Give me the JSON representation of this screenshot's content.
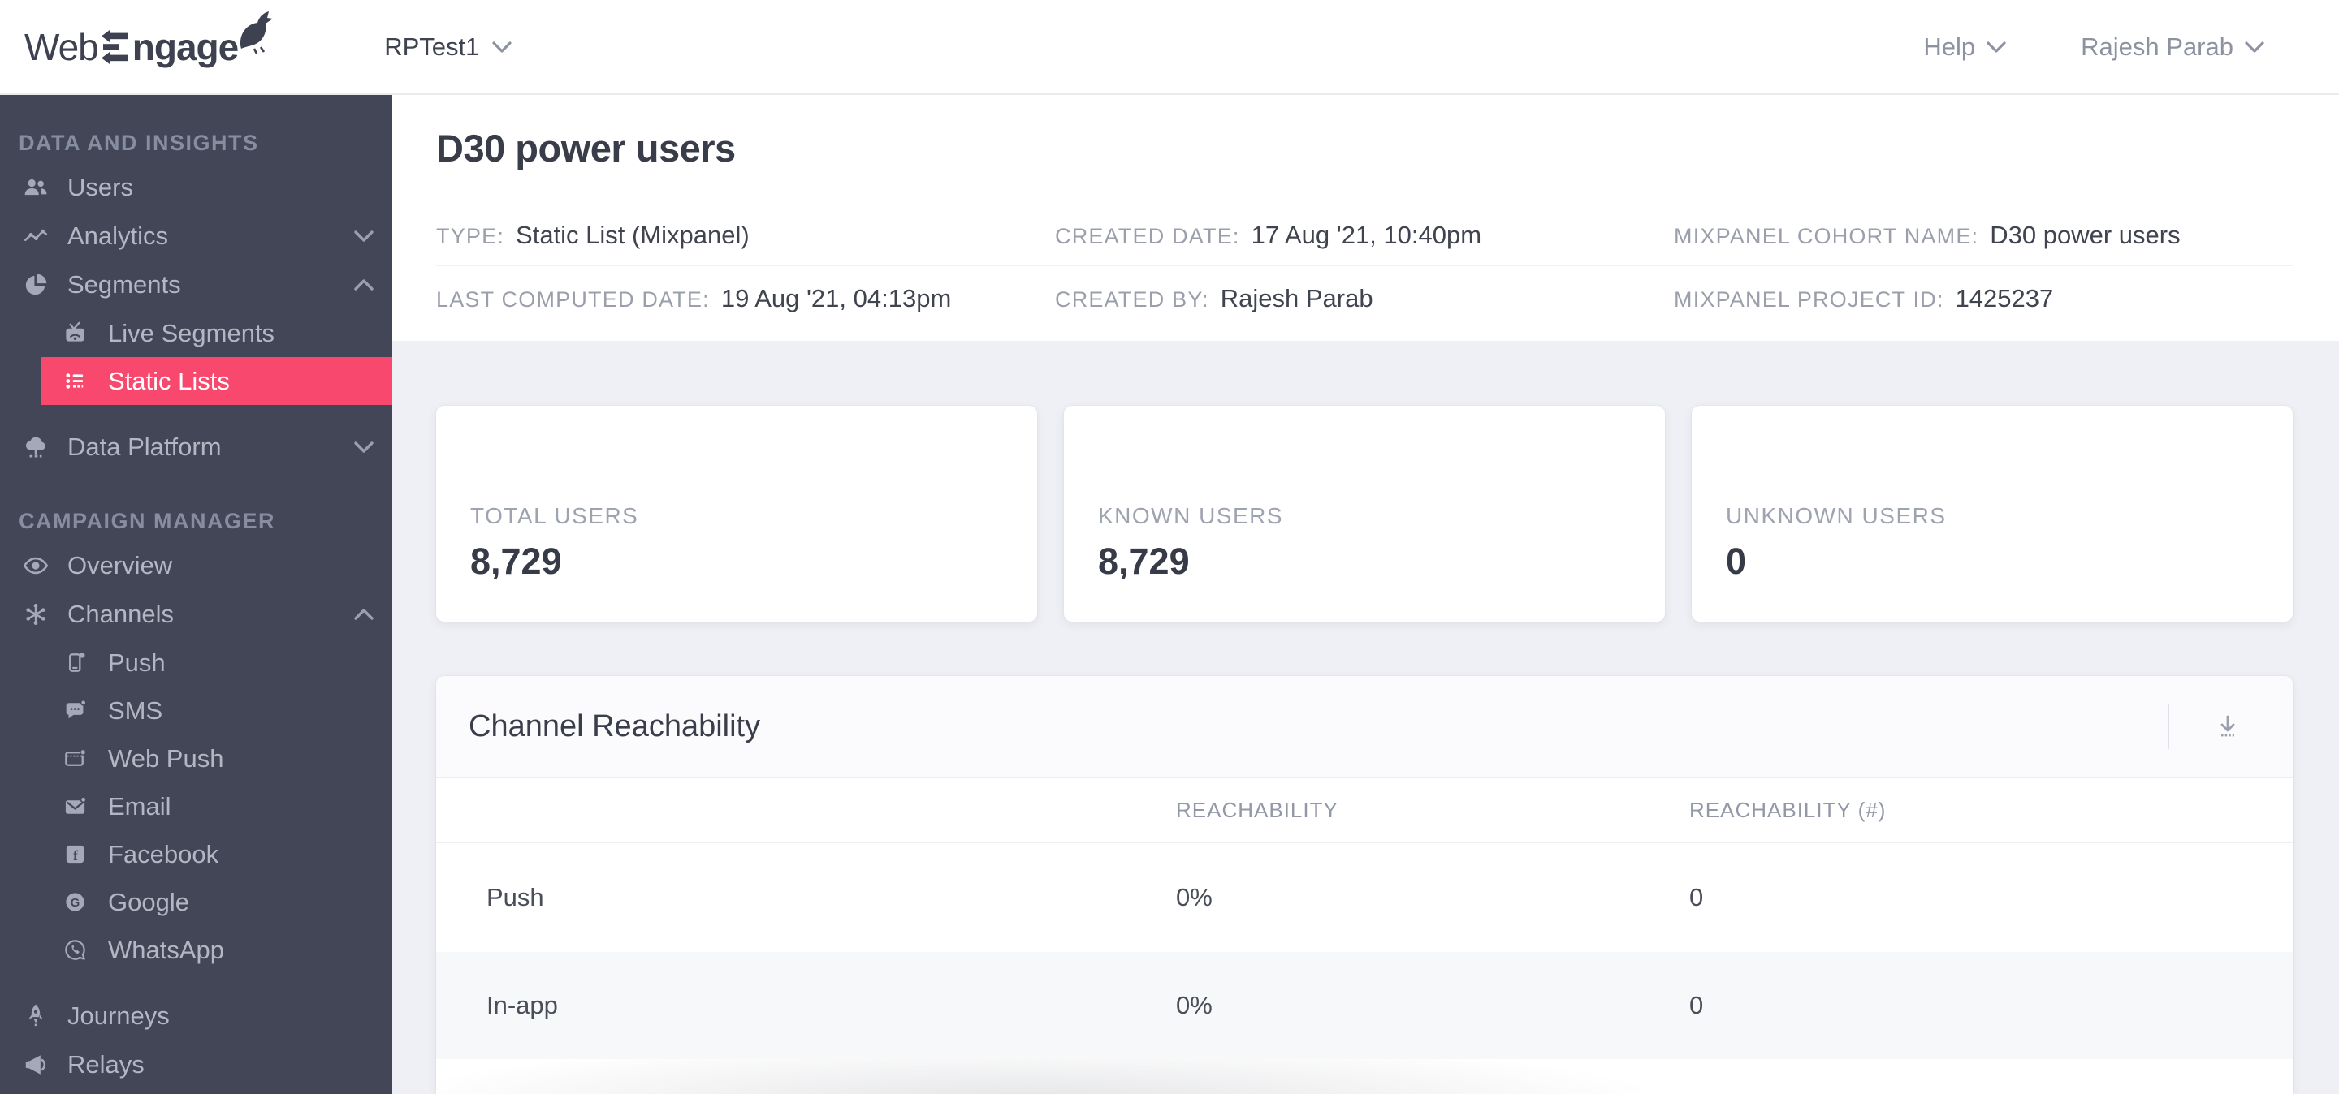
{
  "topbar": {
    "logo_web": "Web",
    "logo_engage": "ngage",
    "project": "RPTest1",
    "help_label": "Help",
    "user_name": "Rajesh Parab"
  },
  "sidebar": {
    "sections": [
      {
        "label": "DATA AND INSIGHTS",
        "items": [
          {
            "label": "Users",
            "icon": "users-icon"
          },
          {
            "label": "Analytics",
            "icon": "analytics-icon",
            "chevron": "down"
          },
          {
            "label": "Segments",
            "icon": "segments-icon",
            "chevron": "up"
          },
          {
            "label": "Live Segments",
            "icon": "live-segments-icon",
            "sub": true
          },
          {
            "label": "Static Lists",
            "icon": "static-lists-icon",
            "sub": true,
            "active": true
          },
          {
            "label": "Data Platform",
            "icon": "data-platform-icon",
            "chevron": "down"
          }
        ]
      },
      {
        "label": "CAMPAIGN MANAGER",
        "items": [
          {
            "label": "Overview",
            "icon": "overview-eye-icon"
          },
          {
            "label": "Channels",
            "icon": "channels-hub-icon",
            "chevron": "up"
          },
          {
            "label": "Push",
            "icon": "push-phone-icon",
            "sub": true
          },
          {
            "label": "SMS",
            "icon": "sms-bubble-icon",
            "sub": true
          },
          {
            "label": "Web Push",
            "icon": "web-push-icon",
            "sub": true
          },
          {
            "label": "Email",
            "icon": "email-envelope-icon",
            "sub": true
          },
          {
            "label": "Facebook",
            "icon": "facebook-icon",
            "sub": true
          },
          {
            "label": "Google",
            "icon": "google-icon",
            "sub": true
          },
          {
            "label": "WhatsApp",
            "icon": "whatsapp-icon",
            "sub": true
          },
          {
            "label": "Journeys",
            "icon": "journeys-rocket-icon"
          },
          {
            "label": "Relays",
            "icon": "relays-megaphone-icon"
          }
        ]
      }
    ]
  },
  "page": {
    "title": "D30 power users",
    "meta": [
      {
        "label": "TYPE:",
        "value": "Static List (Mixpanel)"
      },
      {
        "label": "CREATED DATE:",
        "value": "17 Aug '21, 10:40pm"
      },
      {
        "label": "MIXPANEL COHORT NAME:",
        "value": "D30 power users"
      },
      {
        "label": "LAST COMPUTED DATE:",
        "value": "19 Aug '21, 04:13pm"
      },
      {
        "label": "CREATED BY:",
        "value": "Rajesh Parab"
      },
      {
        "label": "MIXPANEL PROJECT ID:",
        "value": "1425237"
      }
    ]
  },
  "stats": [
    {
      "label": "TOTAL USERS",
      "value": "8,729"
    },
    {
      "label": "KNOWN USERS",
      "value": "8,729"
    },
    {
      "label": "UNKNOWN USERS",
      "value": "0"
    }
  ],
  "reachability": {
    "title": "Channel Reachability",
    "columns": [
      "REACHABILITY",
      "REACHABILITY (#)"
    ],
    "rows": [
      {
        "channel": "Push",
        "reachability": "0%",
        "count": "0"
      },
      {
        "channel": "In-app",
        "reachability": "0%",
        "count": "0"
      }
    ]
  },
  "colors": {
    "accent_pink": "#f9486d",
    "sidebar_bg": "#424656",
    "page_bg": "#eef0f5",
    "text_dark": "#3c404d",
    "text_gray": "#9a9fab"
  }
}
